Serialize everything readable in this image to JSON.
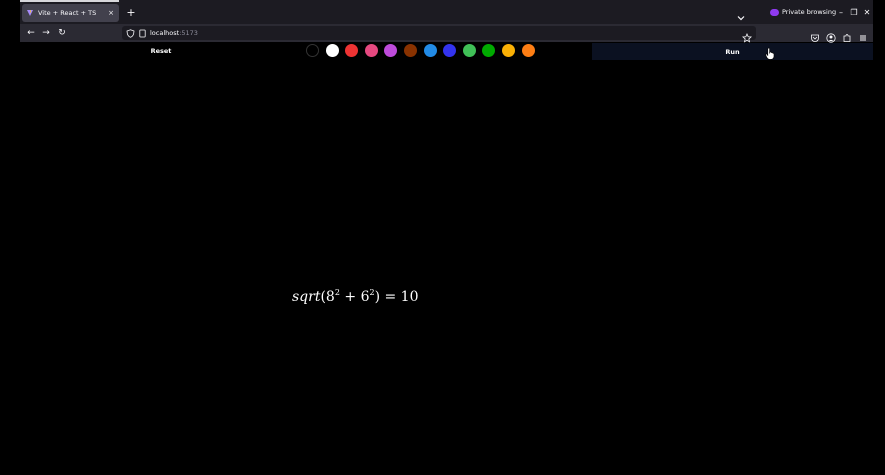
{
  "browser": {
    "tab_title": "Vite + React + TS",
    "tab_close": "×",
    "new_tab": "+",
    "private_label": "Private browsing",
    "url_host": "localhost",
    "url_port": ":5173",
    "controls": {
      "minimize": "–",
      "restore": "❐",
      "close": "✕"
    },
    "nav": {
      "back": "←",
      "forward": "→",
      "reload": "↻"
    }
  },
  "toolbar": {
    "reset_label": "Reset",
    "run_label": "Run",
    "swatches": [
      {
        "name": "black",
        "color": "#000000"
      },
      {
        "name": "white",
        "color": "#ffffff"
      },
      {
        "name": "red",
        "color": "#ee3333"
      },
      {
        "name": "pink",
        "color": "#e64980"
      },
      {
        "name": "purple",
        "color": "#be4bdb"
      },
      {
        "name": "brown",
        "color": "#893200"
      },
      {
        "name": "blue",
        "color": "#228be6"
      },
      {
        "name": "indigo",
        "color": "#3333ee"
      },
      {
        "name": "green",
        "color": "#40c057"
      },
      {
        "name": "dark-green",
        "color": "#00aa00"
      },
      {
        "name": "yellow",
        "color": "#fab005"
      },
      {
        "name": "orange",
        "color": "#fd7e14"
      }
    ]
  },
  "canvas": {
    "result": {
      "func": "sqrt",
      "open": "(8",
      "exp1": "2",
      "plus": " + 6",
      "exp2": "2",
      "close": ") = 10"
    }
  }
}
